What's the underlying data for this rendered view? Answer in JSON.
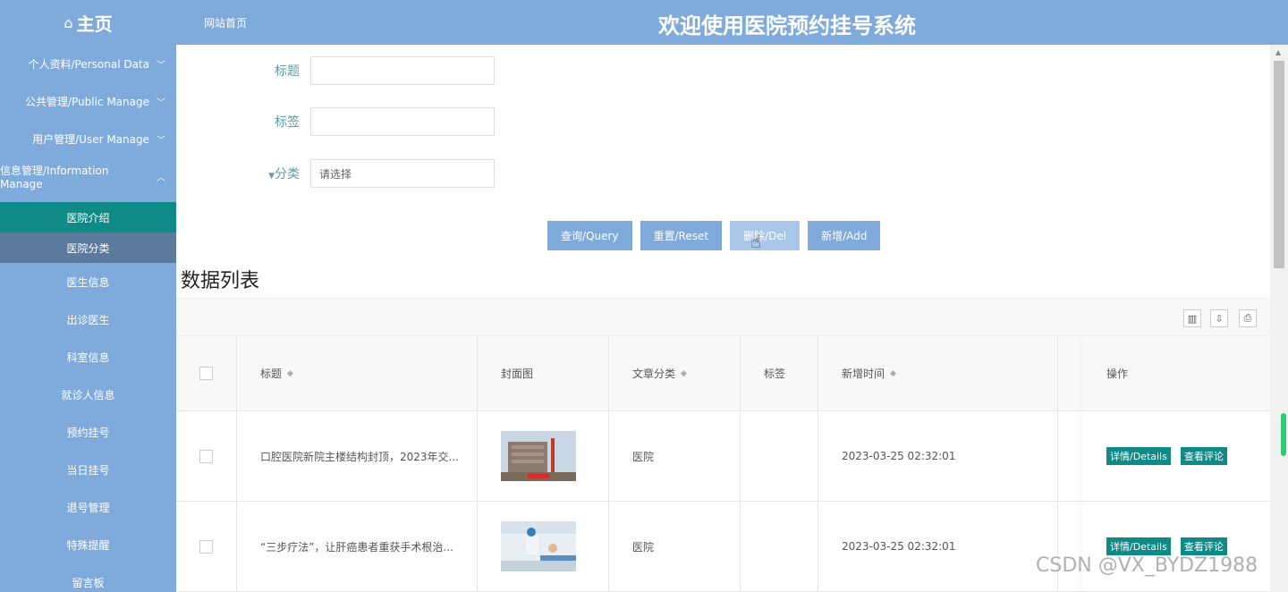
{
  "header": {
    "brand_icon": "home-icon",
    "brand_label": "主页",
    "site_link": "网站首页",
    "system_title": "欢迎使用医院预约挂号系统"
  },
  "sidebar": {
    "groups": [
      {
        "label": "个人资料/Personal Data",
        "expanded": false
      },
      {
        "label": "公共管理/Public Manage",
        "expanded": false
      },
      {
        "label": "用户管理/User Manage",
        "expanded": false
      },
      {
        "label": "信息管理/Information Manage",
        "expanded": true
      }
    ],
    "items": [
      {
        "label": "医院介绍",
        "state": "active"
      },
      {
        "label": "医院分类",
        "state": "hover"
      },
      {
        "label": "医生信息"
      },
      {
        "label": "出诊医生"
      },
      {
        "label": "科室信息"
      },
      {
        "label": "就诊人信息"
      },
      {
        "label": "预约挂号"
      },
      {
        "label": "当日挂号"
      },
      {
        "label": "退号管理"
      },
      {
        "label": "特殊提醒"
      },
      {
        "label": "留言板"
      }
    ]
  },
  "search": {
    "title_label": "标题",
    "title_value": "",
    "tag_label": "标签",
    "tag_value": "",
    "category_label": "分类",
    "category_placeholder": "请选择"
  },
  "buttons": {
    "query": "查询/Query",
    "reset": "重置/Reset",
    "delete": "删除/Del",
    "add": "新增/Add"
  },
  "list": {
    "title": "数据列表",
    "columns": {
      "title": "标题",
      "cover": "封面图",
      "category": "文章分类",
      "tags": "标签",
      "created": "新增时间",
      "actions": "操作"
    },
    "rows": [
      {
        "title": "口腔医院新院主楼结构封顶，2023年交...",
        "category": "医院",
        "tags": "",
        "created": "2023-03-25 02:32:01",
        "details": "详情/Details",
        "comments": "查看评论"
      },
      {
        "title": "“三步疗法”，让肝癌患者重获手术根治...",
        "category": "医院",
        "tags": "",
        "created": "2023-03-25 02:32:01",
        "details": "详情/Details",
        "comments": "查看评论"
      }
    ]
  },
  "watermark": "CSDN @VX_BYDZ1988",
  "colors": {
    "header": "#7faadc",
    "active": "#0f8a86",
    "label": "#5f9ea0"
  }
}
